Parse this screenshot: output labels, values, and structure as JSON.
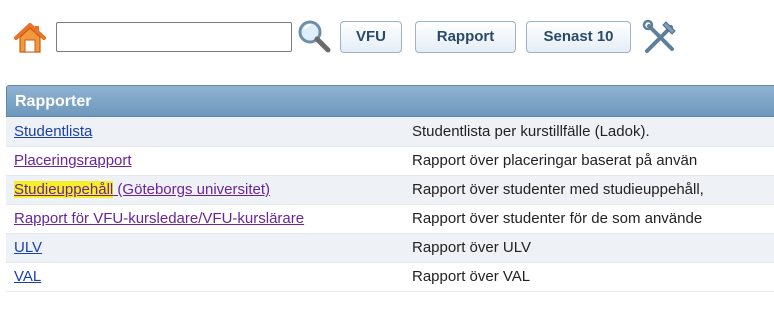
{
  "toolbar": {
    "search_value": "",
    "buttons": {
      "vfu": "VFU",
      "rapport": "Rapport",
      "senast": "Senast 10"
    },
    "icons": {
      "home": "home-icon",
      "search": "search-icon",
      "tools": "tools-icon"
    }
  },
  "panel": {
    "title": "Rapporter",
    "rows": [
      {
        "link": "Studentlista",
        "link_suffix": "",
        "description": "Studentlista per kurstillfälle (Ladok).",
        "visited": false,
        "highlighted": false
      },
      {
        "link": "Placeringsrapport",
        "link_suffix": "",
        "description": "Rapport över placeringar baserat på använ",
        "visited": true,
        "highlighted": false
      },
      {
        "link": "Studieuppehåll",
        "link_suffix": " (Göteborgs universitet)",
        "description": "Rapport över studenter med studieuppehåll,",
        "visited": true,
        "highlighted": true
      },
      {
        "link": "Rapport för VFU-kursledare/VFU-kurslärare",
        "link_suffix": "",
        "description": "Rapport över studenter för de som använde",
        "visited": true,
        "highlighted": false
      },
      {
        "link": "ULV",
        "link_suffix": "",
        "description": "Rapport över ULV",
        "visited": false,
        "highlighted": false
      },
      {
        "link": "VAL",
        "link_suffix": "",
        "description": "Rapport över VAL",
        "visited": false,
        "highlighted": false
      }
    ]
  },
  "colors": {
    "header_bg": "#7fa6c8",
    "link": "#1a3fb0",
    "visited_link": "#6b2496",
    "highlight": "#f5ef2a",
    "row_alt": "#eef2f6"
  }
}
